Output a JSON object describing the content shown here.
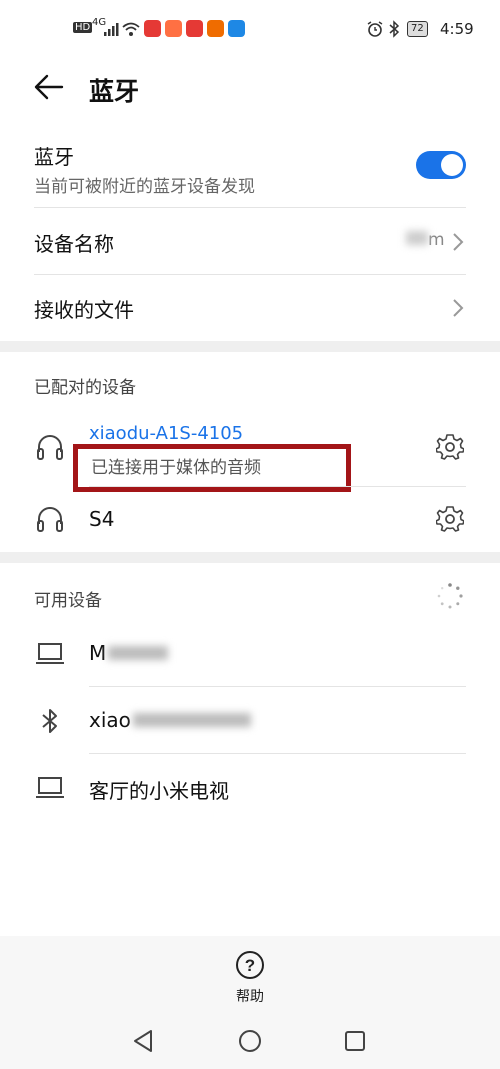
{
  "status_bar": {
    "network": "4G",
    "battery": "72",
    "time": "4:59",
    "hd_badge": "HD",
    "app_icons": [
      {
        "color": "#e53935",
        "name": "app-icon-1"
      },
      {
        "color": "#e53935",
        "name": "app-icon-2"
      },
      {
        "color": "#e53935",
        "name": "app-icon-3"
      },
      {
        "color": "#e53935",
        "name": "app-icon-4"
      },
      {
        "color": "#1e88e5",
        "name": "app-icon-5"
      }
    ]
  },
  "header": {
    "title": "蓝牙"
  },
  "bluetooth": {
    "title": "蓝牙",
    "subtitle": "当前可被附近的蓝牙设备发现",
    "enabled": true
  },
  "device_name": {
    "label": "设备名称",
    "value": "m"
  },
  "received_files": {
    "label": "接收的文件"
  },
  "paired": {
    "title": "已配对的设备",
    "devices": [
      {
        "name": "xiaodu-A1S-4105",
        "status": "已连接用于媒体的音频",
        "icon": "headphones-icon"
      },
      {
        "name": "S4",
        "status": "",
        "icon": "headphones-icon"
      }
    ]
  },
  "available": {
    "title": "可用设备",
    "devices": [
      {
        "name": "M",
        "icon": "laptop-icon"
      },
      {
        "name": "xiao",
        "icon": "bluetooth-icon"
      },
      {
        "name": "客厅的小米电视",
        "icon": "laptop-icon"
      }
    ]
  },
  "help": {
    "label": "帮助",
    "icon": "?"
  },
  "colors": {
    "accent": "#1a73e8",
    "highlight": "#a31518"
  }
}
